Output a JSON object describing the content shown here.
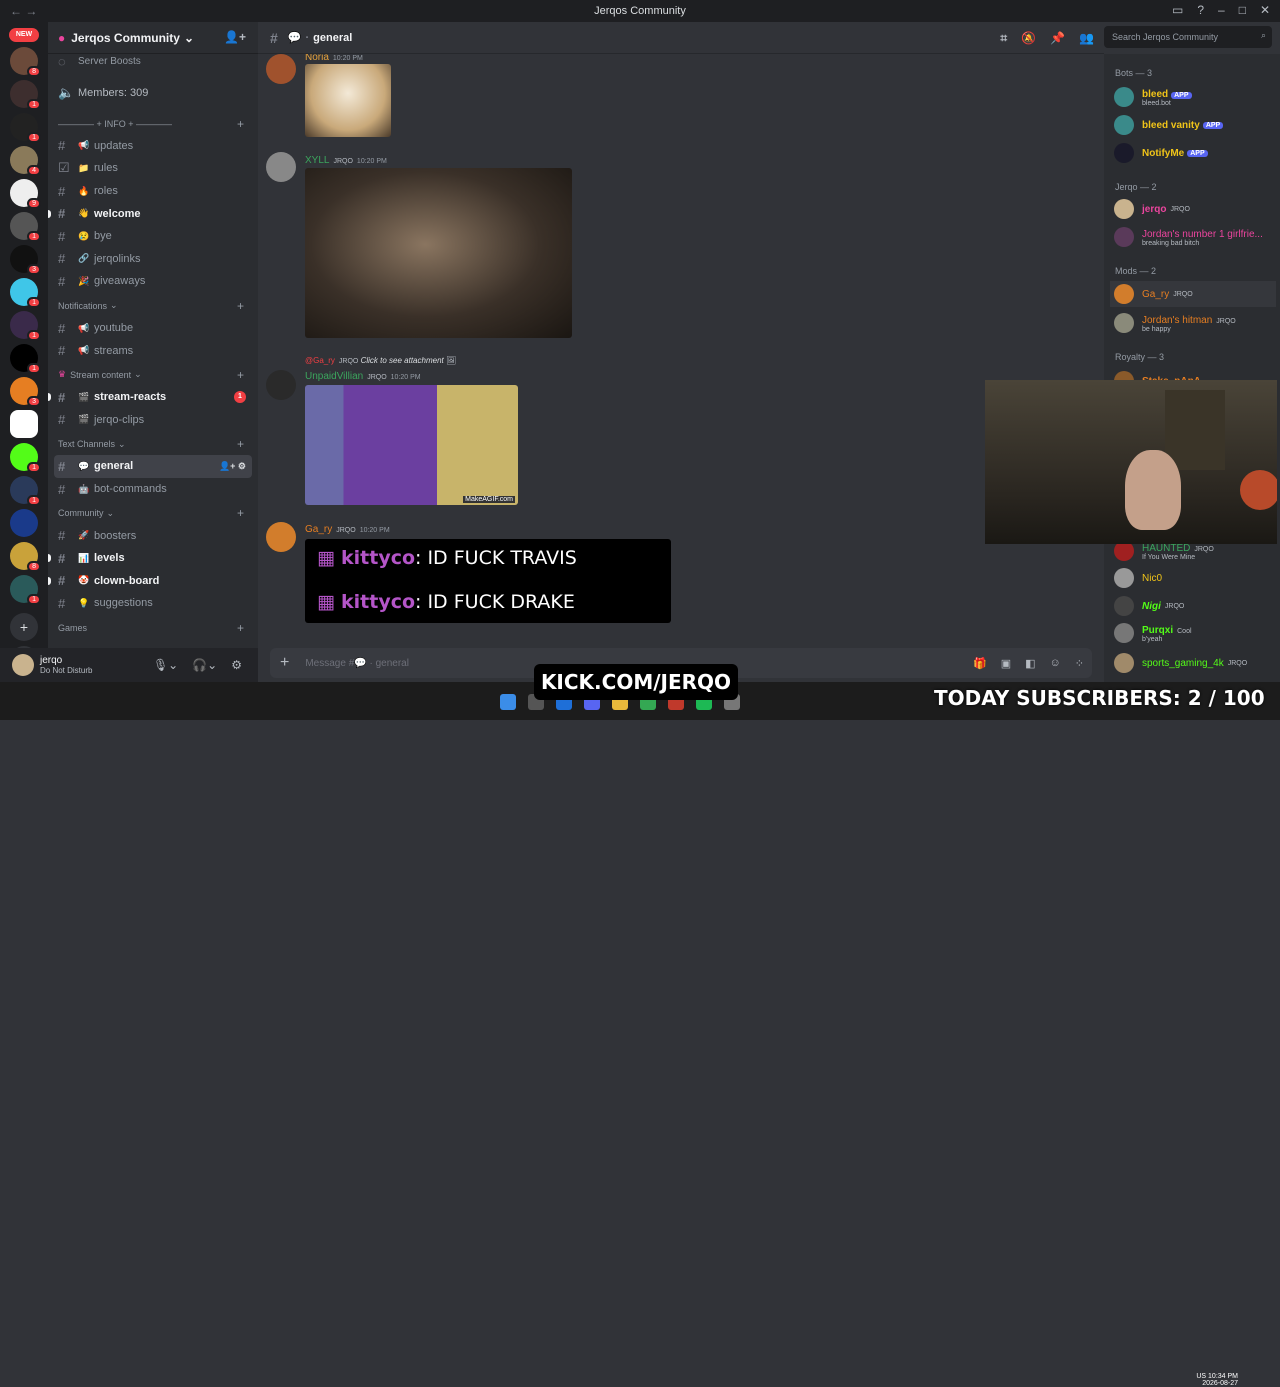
{
  "window": {
    "title": "Jerqos Community"
  },
  "server": {
    "name": "Jerqos Community",
    "boosts": "Server Boosts",
    "members": "Members: 309"
  },
  "categories": {
    "info": "———— + INFO + ————",
    "notifications": "Notifications",
    "stream": "Stream content",
    "text": "Text Channels",
    "community": "Community",
    "games": "Games"
  },
  "channels": {
    "info": [
      {
        "label": "updates"
      },
      {
        "label": "rules"
      },
      {
        "label": "roles"
      },
      {
        "label": "welcome"
      },
      {
        "label": "bye"
      },
      {
        "label": "jerqolinks"
      },
      {
        "label": "giveaways"
      }
    ],
    "notifications": [
      {
        "label": "youtube"
      },
      {
        "label": "streams"
      }
    ],
    "stream": [
      {
        "label": "stream-reacts",
        "badge": "1"
      },
      {
        "label": "jerqo-clips"
      }
    ],
    "text": [
      {
        "label": "general"
      },
      {
        "label": "bot-commands"
      }
    ],
    "community": [
      {
        "label": "boosters"
      },
      {
        "label": "levels"
      },
      {
        "label": "clown-board"
      },
      {
        "label": "suggestions"
      }
    ]
  },
  "user": {
    "name": "jerqo",
    "status": "Do Not Disturb"
  },
  "chat": {
    "channel": "general",
    "search_placeholder": "Search Jerqos Community",
    "composer_placeholder": "Message #💬 · general"
  },
  "messages": [
    {
      "author": "Noria",
      "time": "10:20 PM"
    },
    {
      "author": "XYLL",
      "tag": "JRQO",
      "time": "10:20 PM"
    },
    {
      "reply_author": "@Ga_ry",
      "reply_tag": "JRQO",
      "reply_text": "Click to see attachment",
      "author": "UnpaidVillian",
      "tag": "JRQO",
      "time": "10:20 PM",
      "watermark": "MakeAGIF.com"
    },
    {
      "author": "Ga_ry",
      "tag": "JRQO",
      "time": "10:20 PM",
      "lines": [
        {
          "name": "kittyco",
          "text": ": ID FUCK TRAVIS"
        },
        {
          "name": "kittyco",
          "text": ": ID FUCK DRAKE"
        }
      ]
    }
  ],
  "member_groups": {
    "bots": "Bots — 3",
    "jerqo": "Jerqo — 2",
    "mods": "Mods — 2",
    "royalty": "Royalty — 3"
  },
  "members": {
    "bots": [
      {
        "name": "bleed",
        "badge": "APP",
        "status": "bleed.bot"
      },
      {
        "name": "bleed vanity",
        "badge": "APP"
      },
      {
        "name": "NotifyMe",
        "badge": "APP"
      }
    ],
    "jerqo": [
      {
        "name": "jerqo",
        "tag": "JRQO"
      },
      {
        "name": "Jordan's number 1 girlfrie...",
        "status": "breaking bad bitch"
      }
    ],
    "mods": [
      {
        "name": "Ga_ry",
        "tag": "JRQO"
      },
      {
        "name": "Jordan's hitman",
        "tag": "JRQO",
        "status": "be happy"
      }
    ],
    "royalty": [
      {
        "name": "Stake_pApA"
      }
    ],
    "others": [
      {
        "name": "HAUNTED",
        "tag": "JRQO",
        "status": "If You Were Mine"
      },
      {
        "name": "Nic0"
      },
      {
        "name": "Nigi",
        "tag": "JRQO"
      },
      {
        "name": "Purqxi",
        "tag": "Cool",
        "status": "b'yeah"
      },
      {
        "name": "sports_gaming_4k",
        "tag": "JRQO"
      }
    ]
  },
  "overlay": {
    "kick": "KICK.COM/JERQO",
    "subs": "TODAY SUBSCRIBERS: 2 / 100"
  },
  "clock": {
    "time": "10:34 PM",
    "date": "2026-08-27",
    "lang": "US"
  },
  "guild_badges": [
    "8",
    "1",
    "1",
    "4",
    "9",
    "1",
    "3",
    "1",
    "1",
    "1",
    "3",
    "1",
    "1",
    "8",
    "1",
    "1"
  ],
  "new_label": "NEW",
  "colors": {
    "green": "#3ba55d",
    "red": "#f23f43",
    "orange": "#e67e22",
    "blurple": "#5865f2",
    "kick": "#53fc18",
    "pink": "#eb459e"
  }
}
